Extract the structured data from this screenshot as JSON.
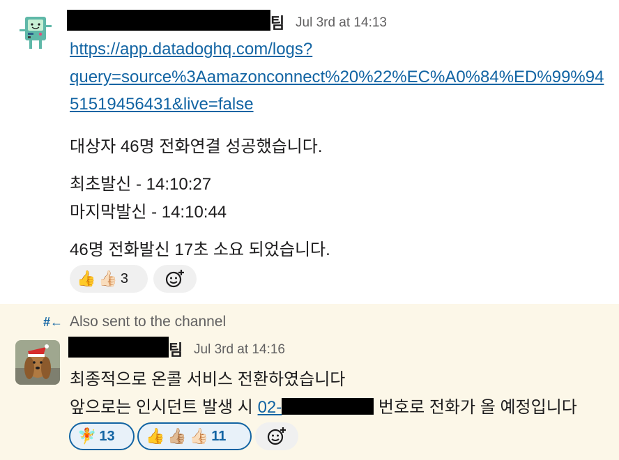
{
  "message1": {
    "name_suffix": "팀",
    "timestamp": "Jul 3rd at 14:13",
    "link_lines": [
      "https://app.datadoghq.com/logs?",
      "query=source%3Aamazonconnect%20%22%EC%A0%84%ED%99%94",
      "51519456431&live=false"
    ],
    "lines": [
      "대상자 46명 전화연결 성공했습니다.",
      "최초발신 - 14:10:27",
      "마지막발신 - 14:10:44",
      "46명 전화발신 17초 소요 되었습니다."
    ],
    "reactions": [
      {
        "emojis": [
          "👍",
          "👍🏻"
        ],
        "count": "3"
      }
    ]
  },
  "also_sent": "Also sent to the channel",
  "message2": {
    "name_suffix": "팀",
    "timestamp": "Jul 3rd at 14:16",
    "line1": "최종적으로 온콜 서비스 전환하였습니다",
    "line2_prefix": "앞으로는 인시던트 발생 시 ",
    "line2_phone": "02-",
    "line2_suffix": " 번호로 전화가 올 예정입니다",
    "reactions": [
      {
        "emojis": [
          "🧚"
        ],
        "count": "13"
      },
      {
        "emojis": [
          "👍",
          "👍🏼",
          "👍🏻"
        ],
        "count": "11"
      }
    ]
  },
  "icons": {
    "add_reaction": "add-reaction-icon",
    "thread_broadcast": "thread-broadcast-icon"
  }
}
